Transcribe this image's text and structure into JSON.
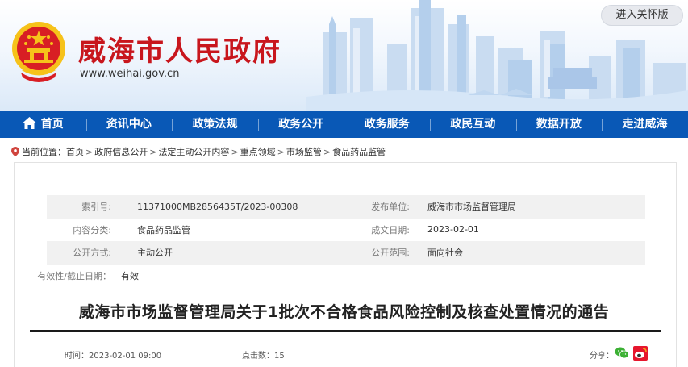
{
  "header": {
    "site_title": "威海市人民政府",
    "site_url": "www.weihai.gov.cn",
    "care_button": "进入关怀版"
  },
  "nav": {
    "items": [
      {
        "label": "首页",
        "icon": "home-icon"
      },
      {
        "label": "资讯中心"
      },
      {
        "label": "政策法规"
      },
      {
        "label": "政务公开"
      },
      {
        "label": "政务服务"
      },
      {
        "label": "政民互动"
      },
      {
        "label": "数据开放"
      },
      {
        "label": "走进威海"
      }
    ]
  },
  "breadcrumb": {
    "prefix": "当前位置：",
    "items": [
      "首页",
      "政府信息公开",
      "法定主动公开内容",
      "重点领域",
      "市场监管",
      "食品药品监管"
    ],
    "separator": ">"
  },
  "meta": {
    "index_label": "索引号:",
    "index_value": "11371000MB2856435T/2023-00308",
    "publisher_label": "发布单位:",
    "publisher_value": "威海市市场监督管理局",
    "category_label": "内容分类:",
    "category_value": "食品药品监管",
    "created_label": "成文日期:",
    "created_value": "2023-02-01",
    "method_label": "公开方式:",
    "method_value": "主动公开",
    "scope_label": "公开范围:",
    "scope_value": "面向社会",
    "validity_label": "有效性/截止日期：",
    "validity_value": "有效"
  },
  "article": {
    "title": "威海市市场监督管理局关于1批次不合格食品风险控制及核查处置情况的通告",
    "time_label": "时间：",
    "time_value": "2023-02-01 09:00",
    "clicks_label": "点击数：",
    "clicks_value": "15",
    "share_label": "分享："
  },
  "colors": {
    "brand_red": "#c8161d",
    "nav_blue": "#0958b6",
    "meta_shade": "#f1f1f1"
  }
}
